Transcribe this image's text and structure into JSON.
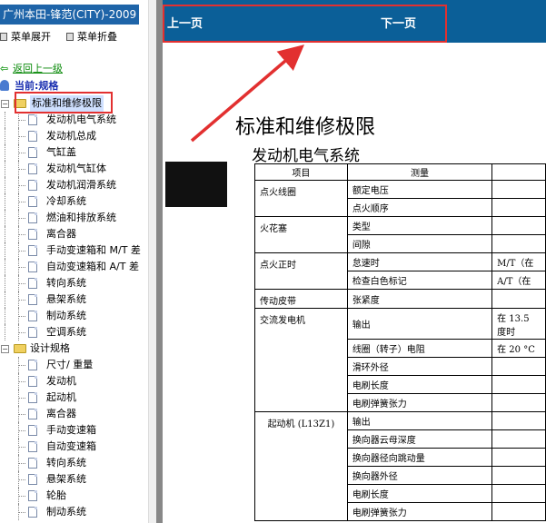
{
  "sidebar": {
    "app_title": "广州本田-锋范(CITY)-2009",
    "expand_label": "菜单展开",
    "collapse_label": "菜单折叠",
    "back_label": "返回上一级",
    "current_label": "当前:规格",
    "folders": [
      {
        "label": "标准和维修极限",
        "selected": true,
        "items": [
          "发动机电气系统",
          "发动机总成",
          "气缸盖",
          "发动机气缸体",
          "发动机润滑系统",
          "冷却系统",
          "燃油和排放系统",
          "离合器",
          "手动变速箱和 M/T 差",
          "自动变速箱和 A/T 差",
          "转向系统",
          "悬架系统",
          "制动系统",
          "空调系统"
        ]
      },
      {
        "label": "设计规格",
        "selected": false,
        "items": [
          "尺寸/ 重量",
          "发动机",
          "起动机",
          "离合器",
          "手动变速箱",
          "自动变速箱",
          "转向系统",
          "悬架系统",
          "轮胎",
          "制动系统"
        ]
      }
    ]
  },
  "nav": {
    "prev_label": "上一页",
    "next_label": "下一页"
  },
  "document": {
    "title": "标准和维修极限",
    "subtitle": "发动机电气系统",
    "table": {
      "headers": [
        "项目",
        "测量",
        ""
      ],
      "rows": [
        [
          "点火线圈",
          "额定电压",
          ""
        ],
        [
          "",
          "点火顺序",
          ""
        ],
        [
          "火花塞",
          "类型",
          ""
        ],
        [
          "",
          "间隙",
          ""
        ],
        [
          "点火正时",
          "怠速时",
          "M/T（在"
        ],
        [
          "",
          "检查白色标记",
          "A/T（在"
        ],
        [
          "传动皮带",
          "张紧度",
          ""
        ],
        [
          "交流发电机",
          "输出",
          "在 13.5 度时"
        ],
        [
          "",
          "线圈（转子）电阻",
          "在 20 °C"
        ],
        [
          "",
          "滑环外径",
          ""
        ],
        [
          "",
          "电刷长度",
          ""
        ],
        [
          "",
          "电刷弹簧张力",
          ""
        ],
        [
          "起动机 (L13Z1)",
          "输出",
          ""
        ],
        [
          "",
          "换向器云母深度",
          ""
        ],
        [
          "",
          "换向器径向跳动量",
          ""
        ],
        [
          "",
          "换向器外径",
          ""
        ],
        [
          "",
          "电刷长度",
          ""
        ],
        [
          "",
          "电刷弹簧张力",
          ""
        ]
      ]
    }
  },
  "colors": {
    "title_bar": "#1e64a8",
    "top_bar": "#0b5f98",
    "highlight": "#e23030",
    "back_link": "#0a8a0a",
    "current": "#1a2fb0"
  }
}
